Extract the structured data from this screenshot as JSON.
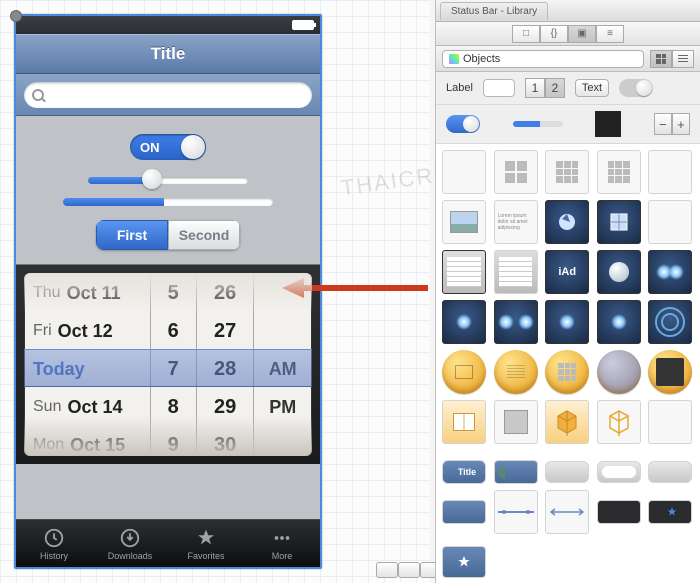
{
  "watermark": "THAICREATE.COM",
  "phone": {
    "navbar_title": "Title",
    "search_placeholder": "",
    "switch_label": "ON",
    "slider_value_pct": 40,
    "progress_value_pct": 48,
    "segmented": {
      "first": "First",
      "second": "Second",
      "active_index": 0
    },
    "tabs": [
      {
        "label": "History",
        "icon": "clock-icon"
      },
      {
        "label": "Downloads",
        "icon": "download-icon"
      },
      {
        "label": "Favorites",
        "icon": "star-icon"
      },
      {
        "label": "More",
        "icon": "more-icon"
      }
    ]
  },
  "picker": {
    "selected_label": "Today",
    "date_col": [
      {
        "weekday": "Thu",
        "date": "Oct 11"
      },
      {
        "weekday": "Fri",
        "date": "Oct 12"
      },
      {
        "weekday": "",
        "date": "Today"
      },
      {
        "weekday": "Sun",
        "date": "Oct 14"
      },
      {
        "weekday": "Mon",
        "date": "Oct 15"
      }
    ],
    "hour_col": [
      "5",
      "6",
      "7",
      "8",
      "9"
    ],
    "minute_col": [
      "26",
      "27",
      "28",
      "29",
      "30"
    ],
    "ampm_col": [
      "",
      "",
      "AM",
      "PM",
      ""
    ]
  },
  "library": {
    "window_tab": "Status Bar - Library",
    "dropdown_label": "Objects",
    "row1": {
      "label_text": "Label",
      "seg1": "1",
      "seg2": "2",
      "text_btn": "Text"
    },
    "iad_label": "iAd",
    "title_chip": "Title"
  }
}
